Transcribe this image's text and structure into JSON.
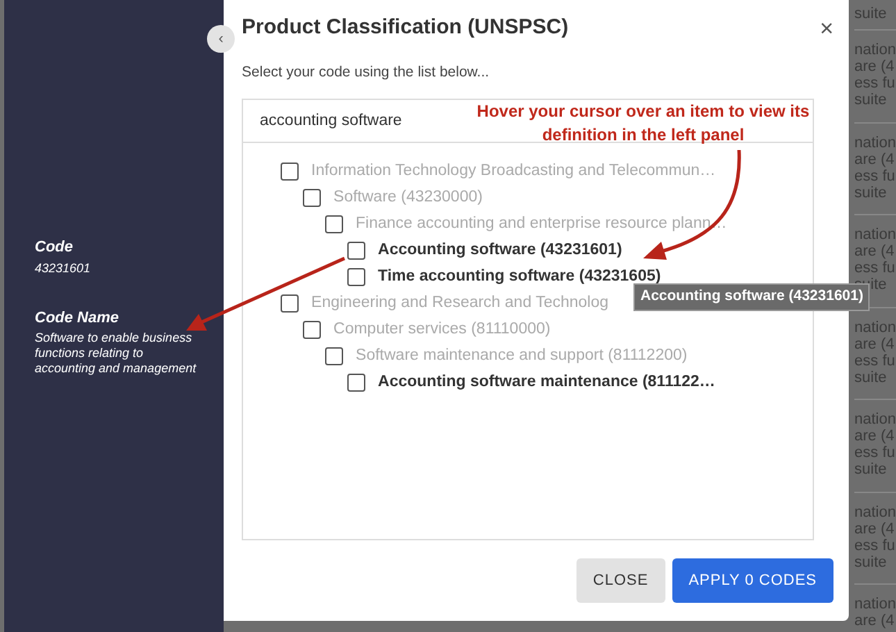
{
  "side_panel": {
    "fields": [
      {
        "label": "Code",
        "value": "43231601"
      },
      {
        "label": "Code Name",
        "value": "Software to enable business functions relating to accounting and management"
      }
    ]
  },
  "dialog": {
    "title": "Product Classification (UNSPSC)",
    "collapse_glyph": "‹",
    "close_glyph": "×",
    "instruction": "Select your code using the list below...",
    "search": {
      "value": "accounting software"
    },
    "tree": [
      {
        "label": "Information Technology Broadcasting and Telecommun…",
        "matched": false,
        "checked": false,
        "children": [
          {
            "label": "Software (43230000)",
            "matched": false,
            "checked": false,
            "children": [
              {
                "label": "Finance accounting and enterprise resource plann…",
                "matched": false,
                "checked": false,
                "children": [
                  {
                    "label": "Accounting software (43231601)",
                    "matched": true,
                    "checked": false
                  },
                  {
                    "label": "Time accounting software (43231605)",
                    "matched": true,
                    "checked": false
                  }
                ]
              }
            ]
          }
        ]
      },
      {
        "label": "Engineering and Research and Technolog",
        "matched": false,
        "checked": false,
        "children": [
          {
            "label": "Computer services (81110000)",
            "matched": false,
            "checked": false,
            "children": [
              {
                "label": "Software maintenance and support (81112200)",
                "matched": false,
                "checked": false,
                "children": [
                  {
                    "label": "Accounting software maintenance (811122…",
                    "matched": true,
                    "checked": false
                  }
                ]
              }
            ]
          }
        ]
      }
    ],
    "buttons": [
      {
        "label": "CLOSE",
        "kind": "secondary"
      },
      {
        "label": "APPLY 0 CODES",
        "kind": "primary"
      }
    ]
  },
  "tooltip": "Accounting software (43231601)",
  "annotation": {
    "text": "Hover your cursor over an item to view its definition in the left panel"
  },
  "background_rows": [
    {
      "lines": [
        "suite"
      ]
    },
    {
      "lines": [
        "nation",
        "are (4",
        "ess fu",
        "suite"
      ]
    },
    {
      "lines": [
        "nation",
        "are (4",
        "ess fu",
        "suite"
      ]
    },
    {
      "lines": [
        "nation",
        "are (4",
        "ess fu",
        "suite"
      ]
    },
    {
      "lines": [
        "nation",
        "are (4",
        "ess fu",
        "suite"
      ]
    },
    {
      "lines": [
        "nation",
        "are (4",
        "ess fu",
        "suite"
      ]
    },
    {
      "lines": [
        "nation",
        "are (4",
        "ess fu",
        "suite"
      ]
    },
    {
      "lines": [
        "nation",
        "are (4"
      ]
    }
  ]
}
